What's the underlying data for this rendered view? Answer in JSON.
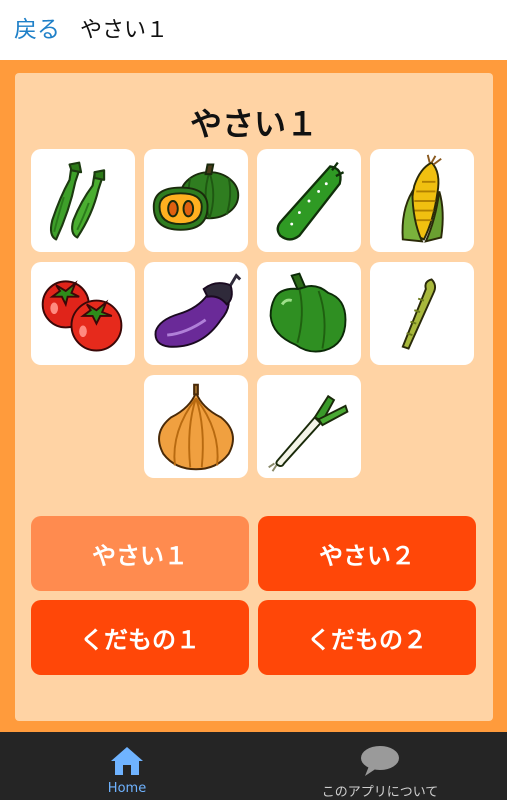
{
  "header": {
    "back_label": "戻る",
    "title": "やさい１"
  },
  "panel": {
    "title": "やさい１",
    "items": [
      {
        "name": "okra-icon"
      },
      {
        "name": "pumpkin-icon"
      },
      {
        "name": "cucumber-icon"
      },
      {
        "name": "corn-icon"
      },
      {
        "name": "tomato-icon"
      },
      {
        "name": "eggplant-icon"
      },
      {
        "name": "green-pepper-icon"
      },
      {
        "name": "asparagus-icon"
      },
      {
        "name": "onion-icon"
      },
      {
        "name": "green-onion-icon"
      }
    ]
  },
  "categories": [
    {
      "label": "やさい１",
      "selected": true
    },
    {
      "label": "やさい２",
      "selected": false
    },
    {
      "label": "くだもの１",
      "selected": false
    },
    {
      "label": "くだもの２",
      "selected": false
    }
  ],
  "colors": {
    "frame": "#ff9b3c",
    "panel": "#ffd3a4",
    "button": "#ff4708",
    "button_selected": "#ff8b4f",
    "nav_bar": "#252525",
    "nav_active": "#6fb3ff",
    "back_link": "#1f80c8"
  },
  "bottom_nav": [
    {
      "label": "Home",
      "icon": "home-icon",
      "active": true
    },
    {
      "label": "このアプリについて",
      "icon": "speech-bubble-icon",
      "active": false
    }
  ]
}
